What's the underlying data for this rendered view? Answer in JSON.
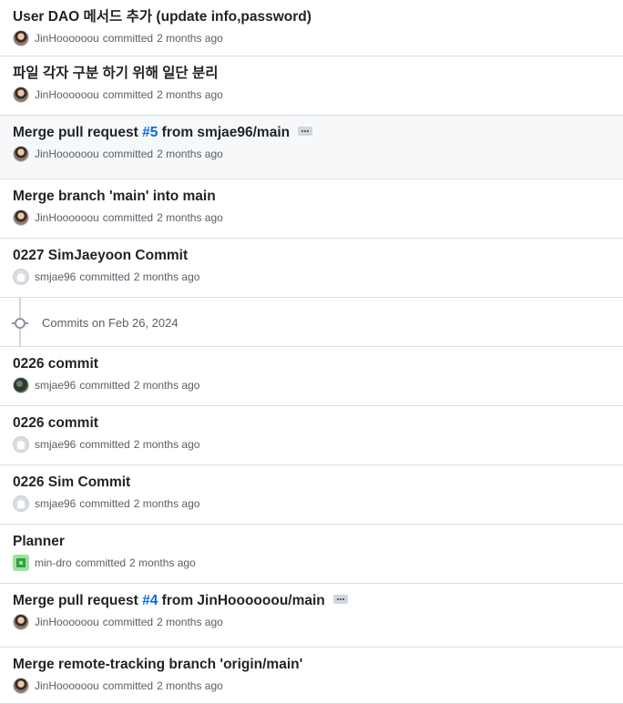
{
  "commits": [
    {
      "title_parts": [
        {
          "text": "User DAO 메서드 추가 (update info,password)",
          "link": false
        }
      ],
      "author": "JinHoooooou",
      "avatar": "photo-avatar",
      "committed": "committed",
      "time": "2 months ago",
      "highlight": false,
      "ellipsis": false
    },
    {
      "title_parts": [
        {
          "text": "파일 각자 구분 하기 위해 일단 분리",
          "link": false
        }
      ],
      "author": "JinHoooooou",
      "avatar": "photo-avatar",
      "committed": "committed",
      "time": "2 months ago",
      "highlight": false,
      "ellipsis": false
    },
    {
      "title_parts": [
        {
          "text": "Merge pull request ",
          "link": false
        },
        {
          "text": "#5",
          "link": true
        },
        {
          "text": " from smjae96/main",
          "link": false
        }
      ],
      "author": "JinHoooooou",
      "avatar": "photo-avatar",
      "committed": "committed",
      "time": "2 months ago",
      "highlight": true,
      "ellipsis": true
    },
    {
      "title_parts": [
        {
          "text": "Merge branch 'main' into main",
          "link": false
        }
      ],
      "author": "JinHoooooou",
      "avatar": "photo-avatar",
      "committed": "committed",
      "time": "2 months ago",
      "highlight": false,
      "ellipsis": false
    },
    {
      "title_parts": [
        {
          "text": "0227 SimJaeyoon Commit",
          "link": false
        }
      ],
      "author": "smjae96",
      "avatar": "ghost-avatar",
      "committed": "committed",
      "time": "2 months ago",
      "highlight": false,
      "ellipsis": false
    }
  ],
  "group_header": {
    "label": "Commits on Feb 26, 2024",
    "icon": "git-commit-icon"
  },
  "commits_after": [
    {
      "title_parts": [
        {
          "text": "0226 commit",
          "link": false
        }
      ],
      "author": "smjae96",
      "avatar": "dark-avatar",
      "committed": "committed",
      "time": "2 months ago",
      "highlight": false,
      "ellipsis": false
    },
    {
      "title_parts": [
        {
          "text": "0226 commit",
          "link": false
        }
      ],
      "author": "smjae96",
      "avatar": "ghost-avatar",
      "committed": "committed",
      "time": "2 months ago",
      "highlight": false,
      "ellipsis": false
    },
    {
      "title_parts": [
        {
          "text": "0226 Sim Commit",
          "link": false
        }
      ],
      "author": "smjae96",
      "avatar": "ghost-avatar",
      "committed": "committed",
      "time": "2 months ago",
      "highlight": false,
      "ellipsis": false
    },
    {
      "title_parts": [
        {
          "text": "Planner",
          "link": false
        }
      ],
      "author": "min-dro",
      "avatar": "identicon-avatar",
      "committed": "committed",
      "time": "2 months ago",
      "highlight": false,
      "ellipsis": false
    },
    {
      "title_parts": [
        {
          "text": "Merge pull request ",
          "link": false
        },
        {
          "text": "#4",
          "link": true
        },
        {
          "text": " from JinHoooooou/main",
          "link": false
        }
      ],
      "author": "JinHoooooou",
      "avatar": "photo-avatar",
      "committed": "committed",
      "time": "2 months ago",
      "highlight": false,
      "ellipsis": true
    },
    {
      "title_parts": [
        {
          "text": "Merge remote-tracking branch 'origin/main'",
          "link": false
        }
      ],
      "author": "JinHoooooou",
      "avatar": "photo-avatar",
      "committed": "committed",
      "time": "2 months ago",
      "highlight": false,
      "ellipsis": false
    }
  ],
  "colors": {
    "link": "#0969da",
    "muted": "#57606a",
    "border": "#d8dee4",
    "highlight_bg": "#f6f8fa"
  }
}
